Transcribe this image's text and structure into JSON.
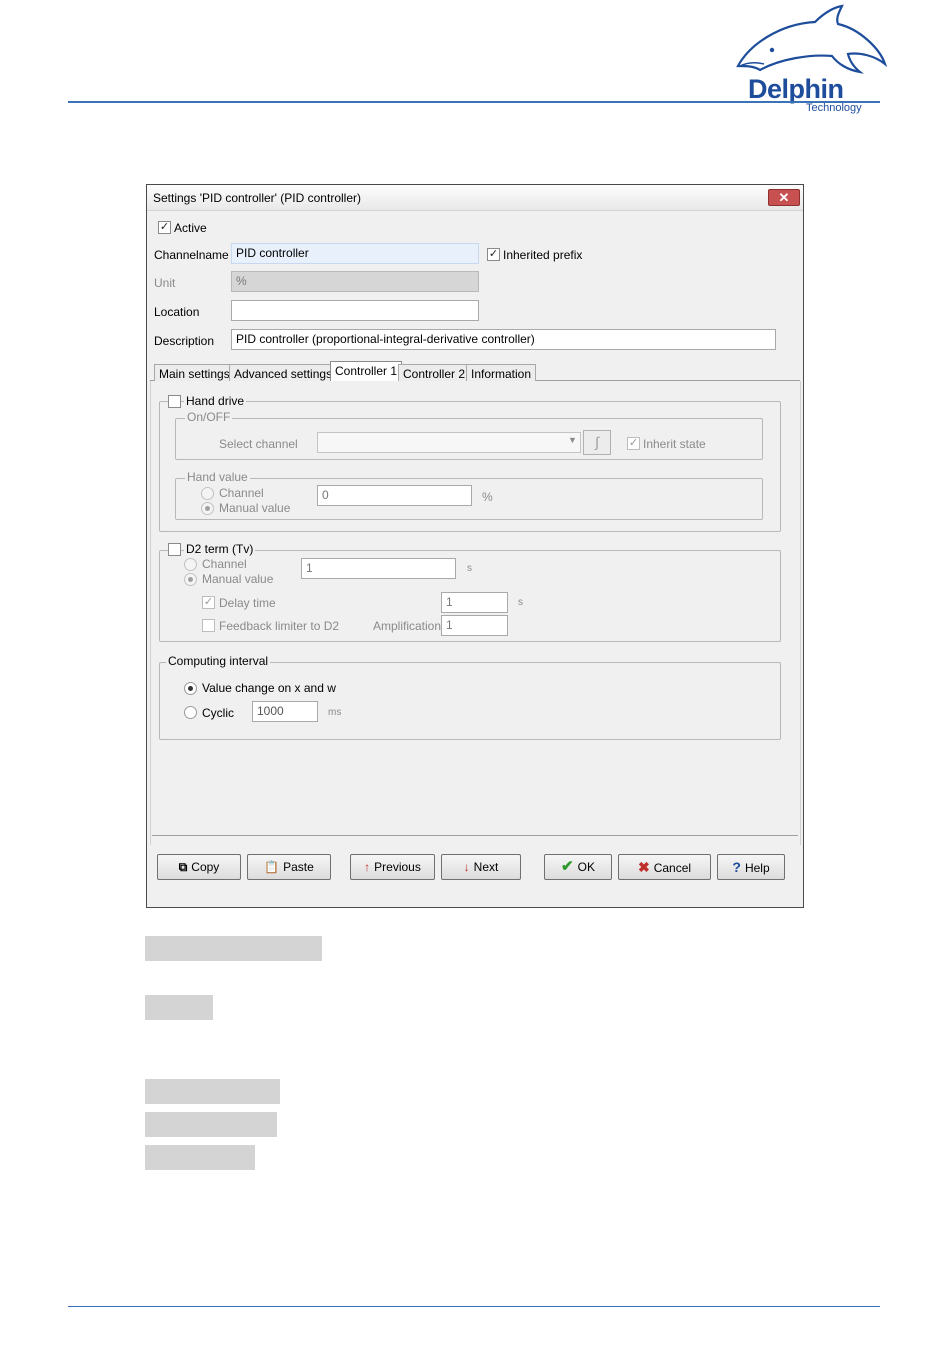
{
  "brand": {
    "logo_text": "Delphin",
    "logo_sub": "Technology"
  },
  "dialog": {
    "title": "Settings 'PID controller' (PID controller)",
    "close_glyph": "✕",
    "active_label": "Active",
    "channelname_label": "Channelname",
    "channelname_value": "PID controller",
    "inherited_prefix_label": "Inherited prefix",
    "unit_label": "Unit",
    "unit_value": "%",
    "location_label": "Location",
    "location_value": "",
    "description_label": "Description",
    "description_value": "PID controller (proportional-integral-derivative controller)",
    "tabs": [
      {
        "label": "Main settings"
      },
      {
        "label": "Advanced settings"
      },
      {
        "label": "Controller 1"
      },
      {
        "label": "Controller 2"
      },
      {
        "label": "Information"
      }
    ],
    "hand_drive": {
      "label": "Hand drive",
      "onoff_group": "On/OFF",
      "select_channel_label": "Select channel",
      "select_channel_value": "",
      "inherit_state_label": "Inherit state",
      "hand_value_group": "Hand value",
      "channel_label": "Channel",
      "manual_value_label": "Manual value",
      "manual_value": "0",
      "unit": "%"
    },
    "d2_term": {
      "label": "D2 term (Tv)",
      "channel_label": "Channel",
      "manual_value_label": "Manual value",
      "manual_value": "1",
      "manual_unit": "s",
      "delay_time_label": "Delay time",
      "delay_time_value": "1",
      "delay_unit": "s",
      "feedback_label": "Feedback limiter to D2",
      "amplification_label": "Amplification:",
      "amplification_value": "1"
    },
    "computing_interval": {
      "label": "Computing interval",
      "value_change_label": "Value change on x and w",
      "cyclic_label": "Cyclic",
      "cyclic_value": "1000",
      "cyclic_unit": "ms"
    },
    "buttons": {
      "copy": "Copy",
      "paste": "Paste",
      "previous": "Previous",
      "next": "Next",
      "ok": "OK",
      "cancel": "Cancel",
      "help": "Help"
    }
  },
  "colors": {
    "accent": "#3b73b9",
    "brand": "#1e4d9c",
    "cancel_icon": "#c0302b",
    "ok_icon": "#2e9a2e"
  }
}
